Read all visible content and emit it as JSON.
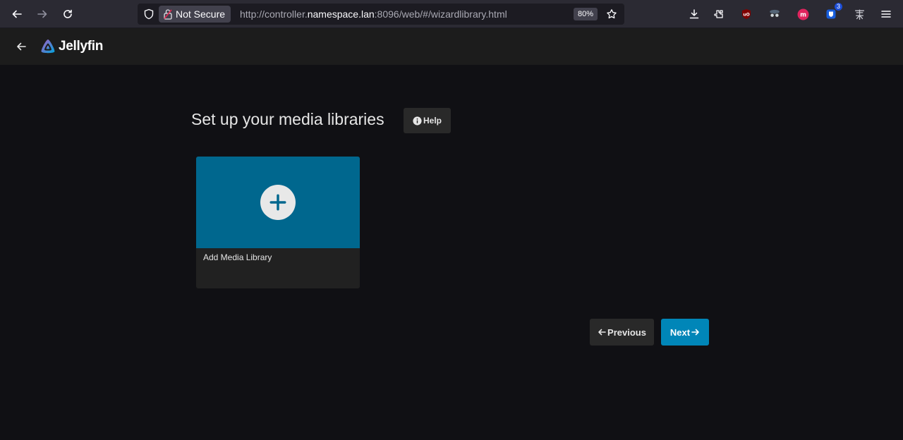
{
  "browser": {
    "security_label": "Not Secure",
    "url_prefix": "http://controller.",
    "url_host": "namespace.lan",
    "url_suffix": ":8096/web/#/wizardlibrary.html",
    "zoom": "80%",
    "extension_badge": "3",
    "icons": [
      "back-icon",
      "forward-icon",
      "reload-icon",
      "shield-icon",
      "lock-icon",
      "star-icon",
      "download-icon",
      "extensions-icon",
      "ublock-icon",
      "spy-icon",
      "mastodon-icon",
      "bitwarden-icon",
      "translate-icon",
      "menu-icon"
    ]
  },
  "app": {
    "name": "Jellyfin"
  },
  "page": {
    "title": "Set up your media libraries",
    "help_label": "Help",
    "card_label": "Add Media Library",
    "previous_label": "Previous",
    "next_label": "Next"
  },
  "colors": {
    "card_accent": "#00678e",
    "next_button": "#0086b8",
    "background": "#101014"
  }
}
